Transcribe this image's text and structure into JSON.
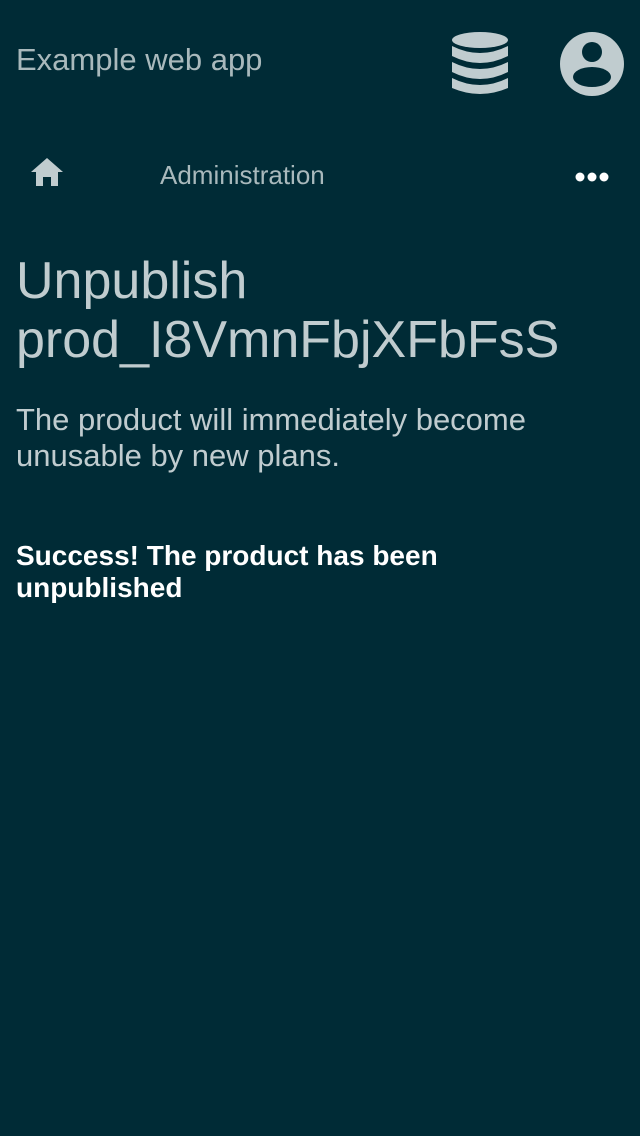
{
  "header": {
    "app_title": "Example web app",
    "icons": [
      "database-icon",
      "account-icon"
    ]
  },
  "breadcrumb": {
    "home_icon": "home-icon",
    "current": "Administration",
    "more_icon": "more-icon"
  },
  "main": {
    "title_line1": "Unpublish",
    "title_line2": "prod_I8VmnFbjXFbFsS",
    "description": "The product will immediately become unusable by new plans.",
    "success_message": "Success! The product has been unpublished"
  },
  "colors": {
    "background": "#002b36",
    "text": "#c0cccf",
    "success": "#ffffff"
  }
}
